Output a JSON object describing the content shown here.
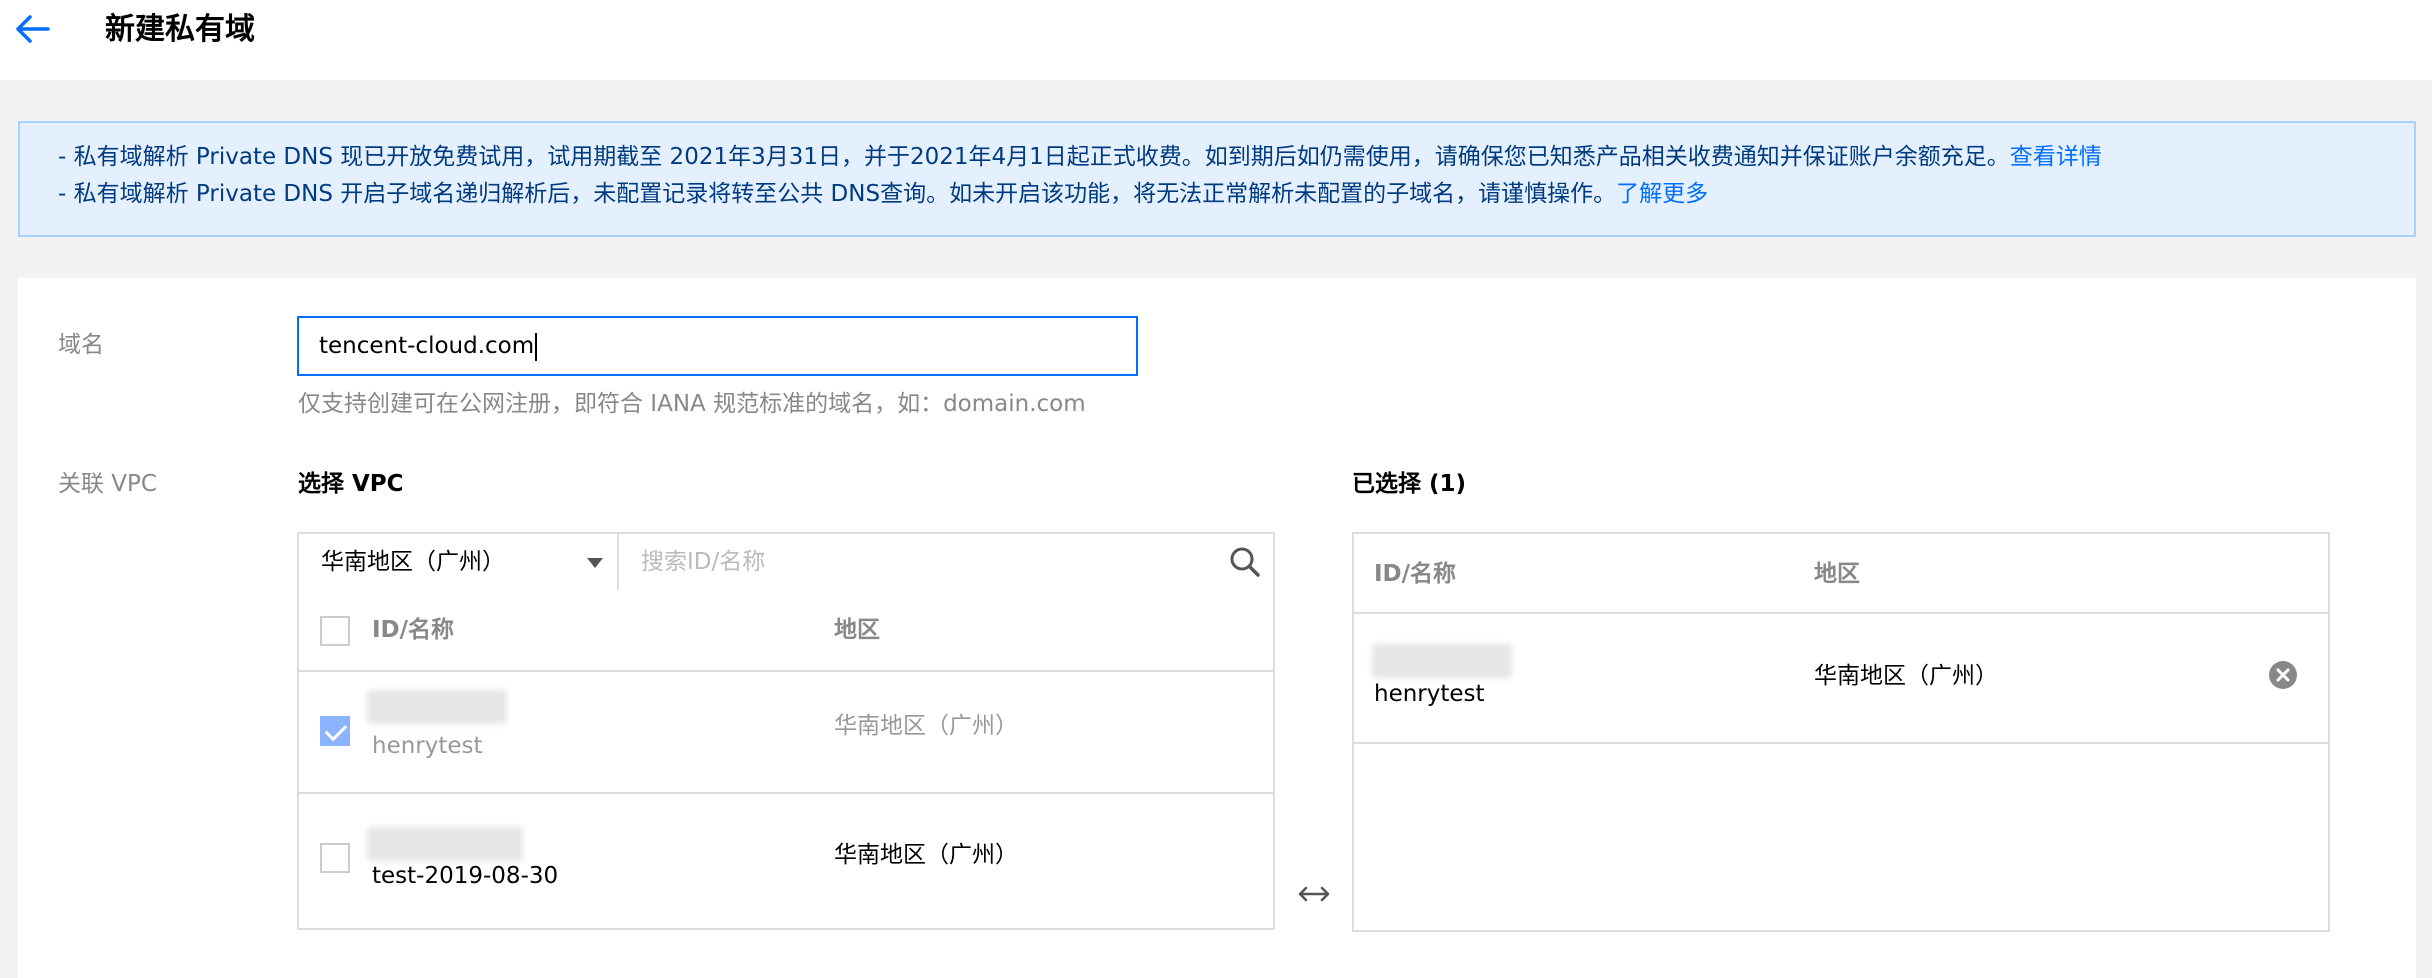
{
  "header": {
    "title": "新建私有域"
  },
  "notice": {
    "line1": "- 私有域解析 Private DNS 现已开放免费试用，试用期截至 2021年3月31日，并于2021年4月1日起正式收费。如到期后如仍需使用，请确保您已知悉产品相关收费通知并保证账户余额充足。",
    "line1_link": "查看详情",
    "line2": "- 私有域解析 Private DNS 开启子域名递归解析后，未配置记录将转至公共 DNS查询。如未开启该功能，将无法正常解析未配置的子域名，请谨慎操作。",
    "line2_link": "了解更多"
  },
  "form": {
    "domain_label": "域名",
    "domain_value": "tencent-cloud.com",
    "domain_hint": "仅支持创建可在公网注册，即符合 IANA 规范标准的域名，如：domain.com",
    "vpc_label": "关联 VPC"
  },
  "vpc_select": {
    "title": "选择 VPC",
    "region_value": "华南地区（广州）",
    "search_placeholder": "搜索ID/名称",
    "columns": [
      "ID/名称",
      "地区"
    ],
    "rows": [
      {
        "name": "henrytest",
        "region": "华南地区（广州）",
        "checked": true,
        "disabled": true
      },
      {
        "name": "test-2019-08-30",
        "region": "华南地区（广州）",
        "checked": false,
        "disabled": false
      }
    ]
  },
  "vpc_selected": {
    "title": "已选择 (1)",
    "columns": [
      "ID/名称",
      "地区"
    ],
    "rows": [
      {
        "name": "henrytest",
        "region": "华南地区（广州）"
      }
    ]
  },
  "colors": {
    "primary": "#006eff",
    "notice_bg": "#e5f0ff",
    "notice_border": "#a8d1ff",
    "notice_text": "#003b80"
  },
  "icons": [
    "arrow-left-icon",
    "chevron-down-icon",
    "search-icon",
    "close-circle-icon",
    "transfer-arrows-icon"
  ]
}
